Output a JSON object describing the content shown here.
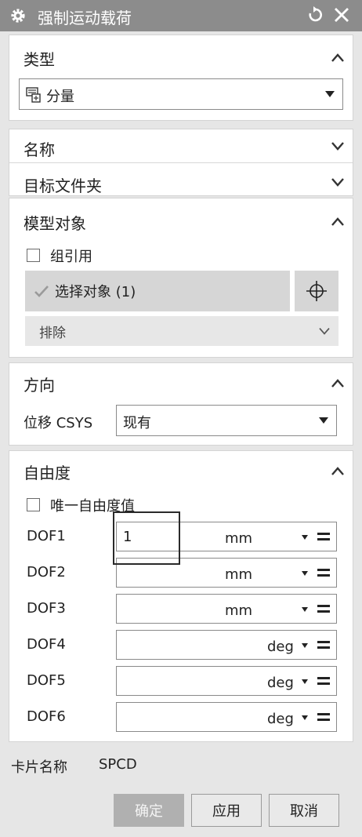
{
  "window": {
    "title": "强制运动载荷"
  },
  "type_section": {
    "title": "类型",
    "selected": "分量"
  },
  "name_section": {
    "title": "名称"
  },
  "target_folder_section": {
    "title": "目标文件夹"
  },
  "model_object_section": {
    "title": "模型对象",
    "group_ref_label": "组引用",
    "select_label": "选择对象 (1)",
    "exclude_label": "排除"
  },
  "direction_section": {
    "title": "方向",
    "csys_label": "位移 CSYS",
    "csys_value": "现有"
  },
  "dof_section": {
    "title": "自由度",
    "unique_label": "唯一自由度值",
    "rows": [
      {
        "label": "DOF1",
        "value": "1",
        "unit": "mm"
      },
      {
        "label": "DOF2",
        "value": "",
        "unit": "mm"
      },
      {
        "label": "DOF3",
        "value": "",
        "unit": "mm"
      },
      {
        "label": "DOF4",
        "value": "",
        "unit": "deg"
      },
      {
        "label": "DOF5",
        "value": "",
        "unit": "deg"
      },
      {
        "label": "DOF6",
        "value": "",
        "unit": "deg"
      }
    ]
  },
  "card_name": {
    "label": "卡片名称",
    "value": "SPCD"
  },
  "buttons": {
    "ok": "确定",
    "apply": "应用",
    "cancel": "取消"
  }
}
